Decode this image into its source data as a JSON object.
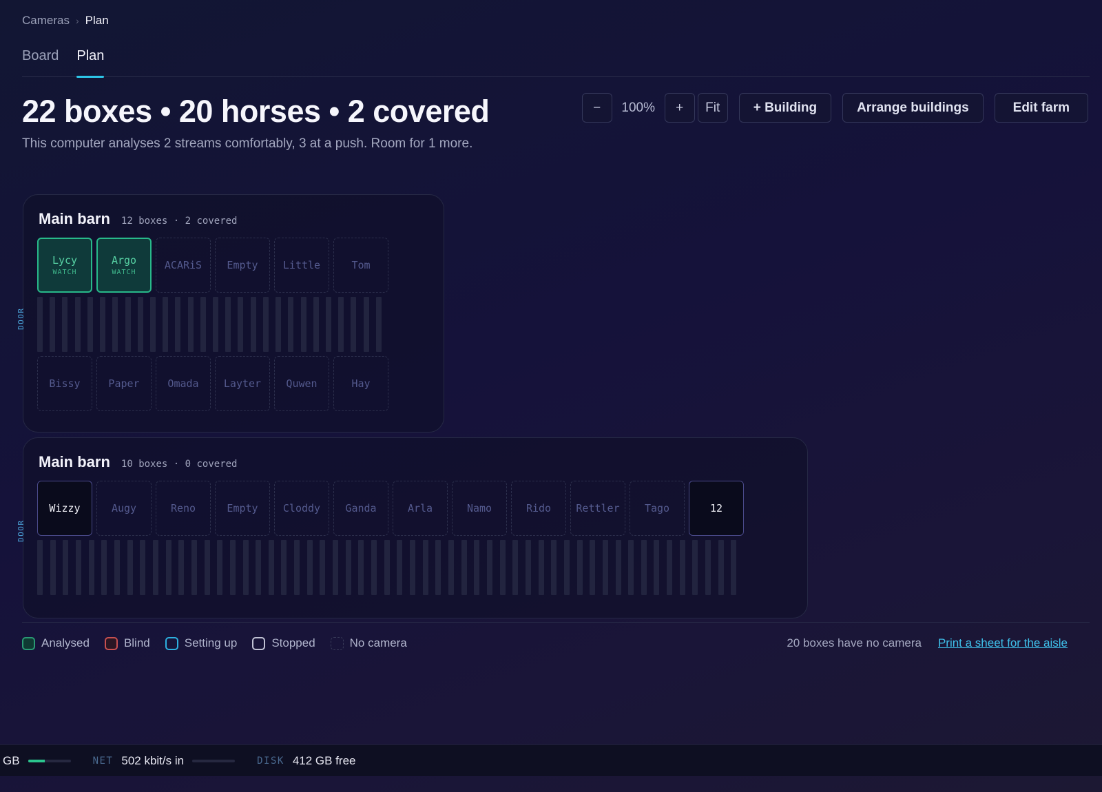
{
  "breadcrumb": {
    "root": "Cameras",
    "separator": "›",
    "current": "Plan"
  },
  "tabs": [
    {
      "label": "Board",
      "active": false
    },
    {
      "label": "Plan",
      "active": true
    }
  ],
  "headline": "22 boxes • 20 horses • 2 covered",
  "subline": "This computer analyses 2 streams comfortably, 3 at a push. Room for 1 more.",
  "toolbar": {
    "zoom_out": "−",
    "zoom_value": "100%",
    "zoom_in": "+",
    "fit": "Fit",
    "add_building": "+ Building",
    "arrange": "Arrange buildings",
    "edit_farm": "Edit farm"
  },
  "barns": [
    {
      "name": "Main barn",
      "meta": "12 boxes · 2 covered",
      "door": "DOOR",
      "top_row": [
        {
          "name": "Lycy",
          "state": "watch",
          "tag": "WATCH"
        },
        {
          "name": "Argo",
          "state": "watch",
          "tag": "WATCH"
        },
        {
          "name": "ACARiS",
          "state": "empty"
        },
        {
          "name": "Empty",
          "state": "empty"
        },
        {
          "name": "Little",
          "state": "empty"
        },
        {
          "name": "Tom",
          "state": "empty"
        }
      ],
      "bottom_row": [
        {
          "name": "Bissy",
          "state": "empty"
        },
        {
          "name": "Paper",
          "state": "empty"
        },
        {
          "name": "Omada",
          "state": "empty"
        },
        {
          "name": "Layter",
          "state": "empty"
        },
        {
          "name": "Quwen",
          "state": "empty"
        },
        {
          "name": "Hay",
          "state": "empty"
        }
      ]
    },
    {
      "name": "Main barn",
      "meta": "10 boxes · 0 covered",
      "door": "DOOR",
      "top_row": [
        {
          "name": "Wizzy",
          "state": "solid"
        },
        {
          "name": "Augy",
          "state": "empty"
        },
        {
          "name": "Reno",
          "state": "empty"
        },
        {
          "name": "Empty",
          "state": "empty"
        },
        {
          "name": "Cloddy",
          "state": "empty"
        },
        {
          "name": "Ganda",
          "state": "empty"
        },
        {
          "name": "Arla",
          "state": "empty"
        },
        {
          "name": "Namo",
          "state": "empty"
        },
        {
          "name": "Rido",
          "state": "empty"
        },
        {
          "name": "Rettler",
          "state": "empty"
        },
        {
          "name": "Tago",
          "state": "empty"
        },
        {
          "name": "12",
          "state": "solid"
        }
      ],
      "bottom_row": []
    }
  ],
  "legend": {
    "analysed": "Analysed",
    "blind": "Blind",
    "setting_up": "Setting up",
    "stopped": "Stopped",
    "no_camera": "No camera",
    "no_camera_count": "20 boxes have no camera",
    "print_link": "Print a sheet for the aisle"
  },
  "statusbar": {
    "mem_value": "GB",
    "mem_fraction": 0.4,
    "net_label": "NET",
    "net_value": "502 kbit/s in",
    "net_fraction": 0.0,
    "disk_label": "DISK",
    "disk_value": "412 GB free"
  },
  "colors": {
    "accent": "#2dc6e8",
    "analysed": "#28b98a",
    "blind": "#c85050"
  }
}
